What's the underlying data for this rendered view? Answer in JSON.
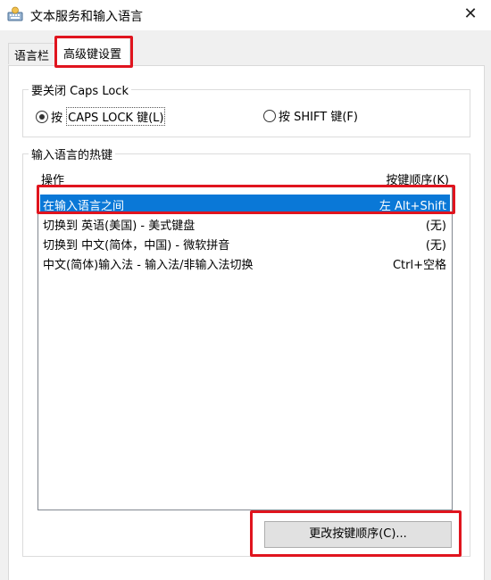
{
  "window": {
    "title": "文本服务和输入语言",
    "icon": "keyboard-globe-icon",
    "close_glyph": "✕"
  },
  "tabs": [
    {
      "label": "语言栏",
      "active": false
    },
    {
      "label": "高级键设置",
      "active": true
    }
  ],
  "caps_lock_group": {
    "title": "要关闭 Caps Lock",
    "options": [
      {
        "prefix": "按 ",
        "label": "CAPS LOCK 键(L)",
        "checked": true
      },
      {
        "prefix": "",
        "label": "按 SHIFT 键(F)",
        "checked": false
      }
    ]
  },
  "hotkeys_group": {
    "title": "输入语言的热键",
    "col_action": "操作",
    "col_sequence": "按键顺序(K)",
    "rows": [
      {
        "action": "在输入语言之间",
        "sequence": "左 Alt+Shift",
        "selected": true
      },
      {
        "action": "切换到 英语(美国) - 美式键盘",
        "sequence": "(无)",
        "selected": false
      },
      {
        "action": "切换到 中文(简体，中国) - 微软拼音",
        "sequence": "(无)",
        "selected": false
      },
      {
        "action": "中文(简体)输入法 - 输入法/非输入法切换",
        "sequence": "Ctrl+空格",
        "selected": false
      }
    ],
    "change_button": "更改按键顺序(C)..."
  },
  "colors": {
    "highlight_box": "#e0141e",
    "selection": "#0a78d7"
  }
}
